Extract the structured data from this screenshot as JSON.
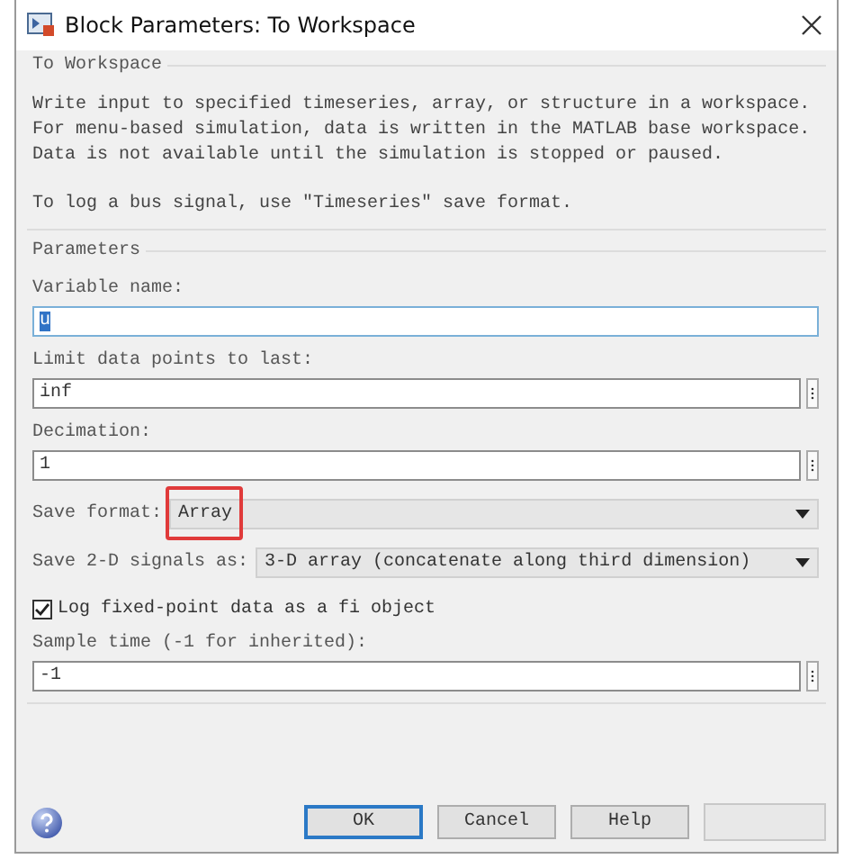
{
  "window": {
    "title": "Block Parameters: To Workspace"
  },
  "description_group": {
    "title": "To Workspace",
    "paragraphs": [
      "Write input to specified timeseries, array, or structure in a workspace.\nFor menu-based simulation, data is written in the MATLAB base workspace.\nData is not available until the simulation is stopped or paused.",
      "To log a bus signal, use \"Timeseries\" save format."
    ]
  },
  "parameters": {
    "title": "Parameters",
    "items": [
      {
        "kind": "text",
        "label": "Variable name:",
        "value": "u",
        "selected": true,
        "menu": false
      },
      {
        "kind": "text",
        "label": "Limit data points to last:",
        "value": "inf",
        "selected": false,
        "menu": true
      },
      {
        "kind": "text",
        "label": "Decimation:",
        "value": "1",
        "selected": false,
        "menu": true
      },
      {
        "kind": "dropdown",
        "label": "Save format:",
        "value": "Array",
        "highlighted": true
      },
      {
        "kind": "dropdown",
        "label": "Save 2-D signals as:",
        "value": "3-D array (concatenate along third dimension)",
        "highlighted": false
      },
      {
        "kind": "checkbox",
        "label": "Log fixed-point data as a fi object",
        "checked": true
      },
      {
        "kind": "text",
        "label": "Sample time (-1 for inherited):",
        "value": "-1",
        "selected": false,
        "menu": true
      }
    ]
  },
  "buttons": [
    {
      "label": "OK",
      "default": true
    },
    {
      "label": "Cancel",
      "default": false
    },
    {
      "label": "Help",
      "default": false
    }
  ]
}
